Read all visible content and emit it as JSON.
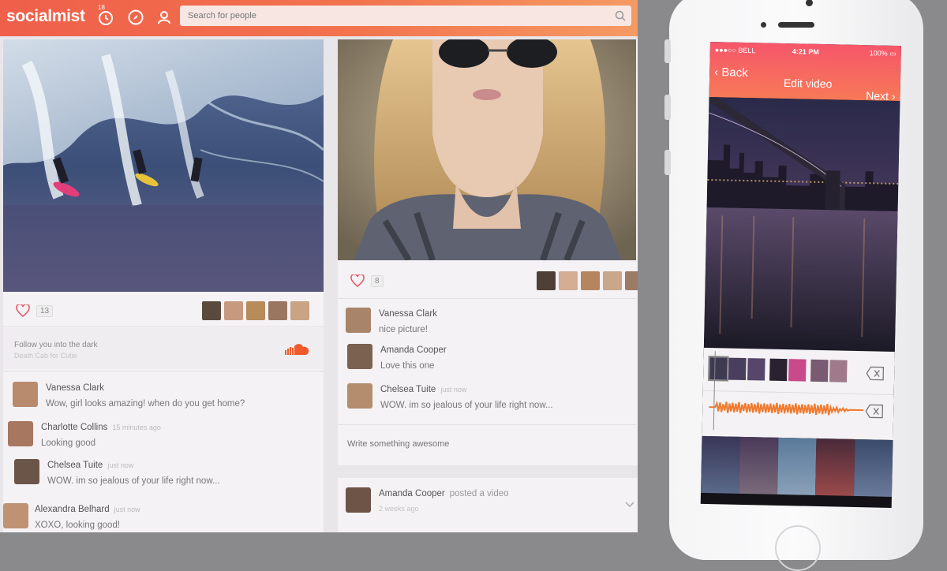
{
  "app": {
    "logo": "socialmist",
    "notifications_badge": "18"
  },
  "search": {
    "placeholder": "Search for people"
  },
  "post1": {
    "likes": "13",
    "song_title": "Follow you into the dark",
    "song_subtitle": "Death Cab for Cutie",
    "comments": [
      {
        "name": "Vanessa Clark",
        "time": "",
        "text": "Wow, girl looks amazing! when do you get home?"
      },
      {
        "name": "Charlotte Collins",
        "time": "15 minutes ago",
        "text": "Looking good"
      },
      {
        "name": "Chelsea Tuite",
        "time": "just now",
        "text": "WOW. im so jealous of your life right now..."
      },
      {
        "name": "Alexandra Belhard",
        "time": "just now",
        "text": "XOXO, looking good!"
      }
    ]
  },
  "post2": {
    "likes": "8",
    "comments": [
      {
        "name": "Vanessa Clark",
        "time": "",
        "text": "nice picture!"
      },
      {
        "name": "Amanda Cooper",
        "time": "",
        "text": "Love this one"
      },
      {
        "name": "Chelsea Tuite",
        "time": "just now",
        "text": "WOW. im so jealous of your life right now..."
      }
    ],
    "reply_placeholder": "Write something awesome"
  },
  "post3": {
    "name": "Amanda Cooper",
    "action": "posted a video",
    "time": "2 weeks ago"
  },
  "phone": {
    "carrier": "BELL",
    "time": "4:21 PM",
    "battery": "100%",
    "back_label": "Back",
    "title": "Edit video",
    "next_label": "Next"
  },
  "colors": {
    "brand_orange": "#f2734e",
    "brand_red": "#ef5f4a",
    "wave": "#f07a2e"
  }
}
